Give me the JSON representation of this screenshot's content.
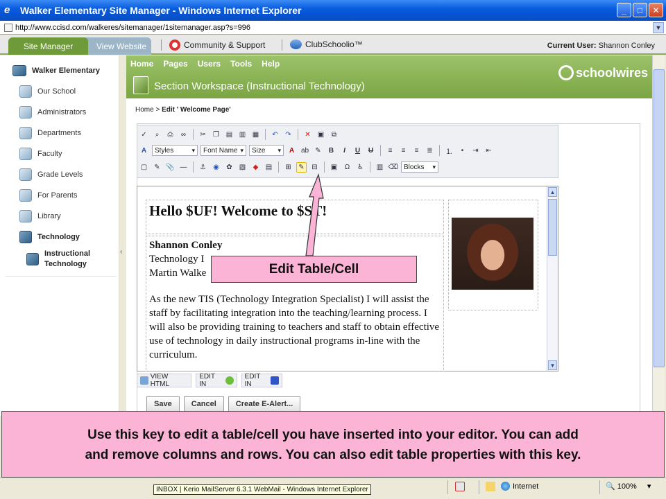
{
  "window": {
    "title": "Walker Elementary Site Manager - Windows Internet Explorer",
    "url": "http://www.ccisd.com/walkeres/sitemanager/1sitemanager.asp?s=996"
  },
  "topnav": {
    "tab_site_manager": "Site Manager",
    "tab_view_website": "View Website",
    "community": "Community & Support",
    "clubschoolio": "ClubSchoolio™",
    "current_user_label": "Current User:",
    "current_user": "Shannon Conley"
  },
  "sidebar": {
    "school": "Walker Elementary",
    "items": [
      "Our School",
      "Administrators",
      "Departments",
      "Faculty",
      "Grade Levels",
      "For Parents",
      "Library",
      "Technology"
    ],
    "subitem": "Instructional Technology"
  },
  "header": {
    "menu": [
      "Home",
      "Pages",
      "Users",
      "Tools",
      "Help"
    ],
    "section_title": "Section Workspace",
    "section_sub": "(Instructional Technology)",
    "logo": "schoolwires"
  },
  "breadcrumb": {
    "home": "Home >",
    "current": "Edit ' Welcome Page'"
  },
  "toolbar": {
    "styles": "Styles",
    "font_name": "Font Name",
    "size": "Size",
    "bold": "B",
    "italic": "I",
    "underline": "U",
    "blocks": "Blocks"
  },
  "editor": {
    "heading": "Hello $UF! Welcome to $ST!",
    "contact_name": "Shannon Conley",
    "contact_line2": "Technology I",
    "contact_line3": "Martin Walke",
    "bio": "As the new TIS (Technology Integration Specialist) I will assist the staff by facilitating integration into the teaching/learning process. I will also be providing training to teachers and staff to obtain effective use of technology in daily instructional programs in-line with the curriculum."
  },
  "editor_tabs": [
    "VIEW HTML",
    "EDIT IN",
    "EDIT IN"
  ],
  "buttons": {
    "save": "Save",
    "cancel": "Cancel",
    "create_alert": "Create E-Alert..."
  },
  "callout": "Edit Table/Cell",
  "banner": {
    "line1": "Use this key to edit a table/cell you have inserted into your editor. You can add",
    "line2": "and remove columns and rows.  You can also edit table properties with this key."
  },
  "statusbar": {
    "taskbar_tip": "INBOX | Kerio MailServer 6.3.1 WebMail - Windows Internet Explorer",
    "zone": "Internet",
    "zoom": "100%"
  },
  "colors": {
    "accent_green": "#7ba643",
    "callout_pink": "#fbb4d6",
    "titlebar_blue": "#0a5ee0"
  }
}
